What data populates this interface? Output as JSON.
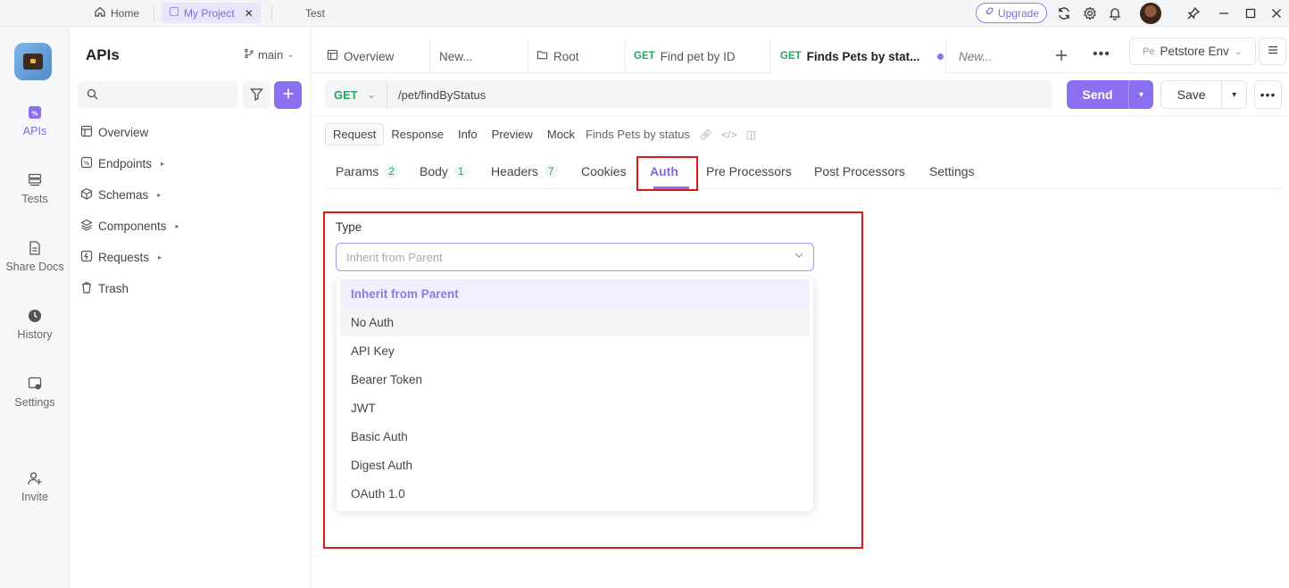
{
  "titlebar": {
    "home": "Home",
    "project": "My Project",
    "test": "Test",
    "upgrade": "Upgrade"
  },
  "rail": {
    "items": [
      "APIs",
      "Tests",
      "Share Docs",
      "History",
      "Settings",
      "Invite"
    ]
  },
  "sidepanel": {
    "title": "APIs",
    "branch": "main",
    "search_placeholder": "",
    "tree": [
      "Overview",
      "Endpoints",
      "Schemas",
      "Components",
      "Requests",
      "Trash"
    ]
  },
  "tabs": {
    "items": [
      {
        "label": "Overview"
      },
      {
        "label": "New..."
      },
      {
        "label": "Root"
      },
      {
        "method": "GET",
        "label": "Find pet by ID"
      },
      {
        "method": "GET",
        "label": "Finds Pets by stat..."
      },
      {
        "label": "New..."
      }
    ],
    "env": "Petstore Env",
    "env_prefix": "Pe"
  },
  "request": {
    "method": "GET",
    "url": "/pet/findByStatus",
    "send": "Send",
    "save": "Save"
  },
  "subtabs": {
    "items": [
      "Request",
      "Response",
      "Info",
      "Preview",
      "Mock"
    ],
    "description": "Finds Pets by status"
  },
  "reqtabs": {
    "params": "Params",
    "params_count": "2",
    "body": "Body",
    "body_count": "1",
    "headers": "Headers",
    "headers_count": "7",
    "cookies": "Cookies",
    "auth": "Auth",
    "pre": "Pre Processors",
    "post": "Post Processors",
    "settings": "Settings"
  },
  "auth": {
    "type_label": "Type",
    "selected": "Inherit from Parent",
    "options": [
      "Inherit from Parent",
      "No Auth",
      "API Key",
      "Bearer Token",
      "JWT",
      "Basic Auth",
      "Digest Auth",
      "OAuth 1.0"
    ]
  },
  "colors": {
    "accent": "#8c6ff0",
    "get": "#2aa464",
    "highlight": "#d9191e"
  }
}
